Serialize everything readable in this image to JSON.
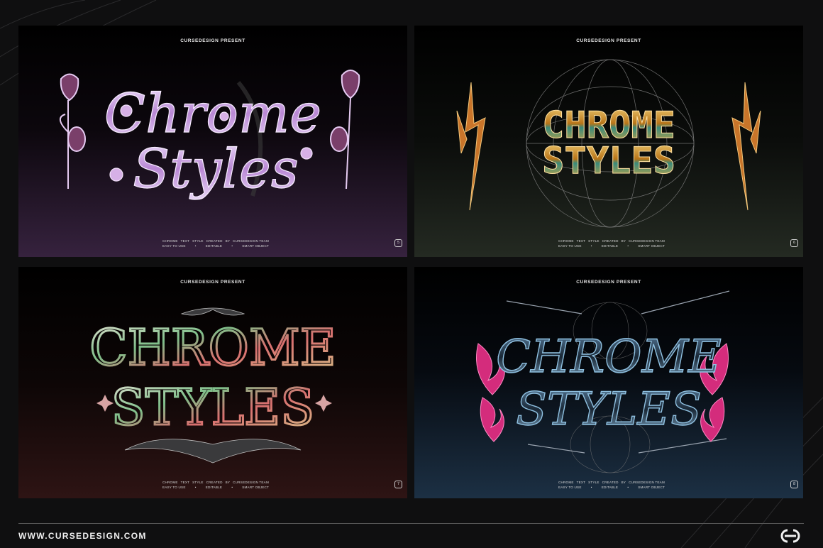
{
  "cards": [
    {
      "present": "CURSEDESIGN PRESENT",
      "title_line1": "Chrome",
      "title_line2": "Styles",
      "meta_row1": [
        "CHROME",
        "TEXT",
        "STYLE",
        "CREATED",
        "BY",
        "CURSEDESIGN TEAM"
      ],
      "meta_row2": [
        "EASY TO USE",
        "•",
        "EDITABLE",
        "•",
        "SMART OBJECT"
      ],
      "number": "5"
    },
    {
      "present": "CURSEDESIGN PRESENT",
      "title_line1": "CHROME",
      "title_line2": "STYLES",
      "meta_row1": [
        "CHROME",
        "TEXT",
        "STYLE",
        "CREATED",
        "BY",
        "CURSEDESIGN TEAM"
      ],
      "meta_row2": [
        "EASY TO USE",
        "•",
        "EDITABLE",
        "•",
        "SMART OBJECT"
      ],
      "number": "6"
    },
    {
      "present": "CURSEDESIGN PRESENT",
      "title_line1": "CHROME",
      "title_line2": "STYLES",
      "meta_row1": [
        "CHROME",
        "TEXT",
        "STYLE",
        "CREATED",
        "BY",
        "CURSEDESIGN TEAM"
      ],
      "meta_row2": [
        "EASY TO USE",
        "•",
        "EDITABLE",
        "•",
        "SMART OBJECT"
      ],
      "number": "7"
    },
    {
      "present": "CURSEDESIGN PRESENT",
      "title_line1": "CHROME",
      "title_line2": "STYLES",
      "meta_row1": [
        "CHROME",
        "TEXT",
        "STYLE",
        "CREATED",
        "BY",
        "CURSEDESIGN TEAM"
      ],
      "meta_row2": [
        "EASY TO USE",
        "•",
        "EDITABLE",
        "•",
        "SMART OBJECT"
      ],
      "number": "8"
    }
  ],
  "footer": {
    "url": "WWW.CURSEDESIGN.COM",
    "logo_icon": "cursedesign-logo-icon"
  },
  "colors": {
    "page_bg": "#0f0f10",
    "card1_accent": "#c48fd8",
    "card2_accent": "#d99a2b",
    "card3_accent": "#c9c3b8",
    "card4_accent": "#e0338c"
  }
}
